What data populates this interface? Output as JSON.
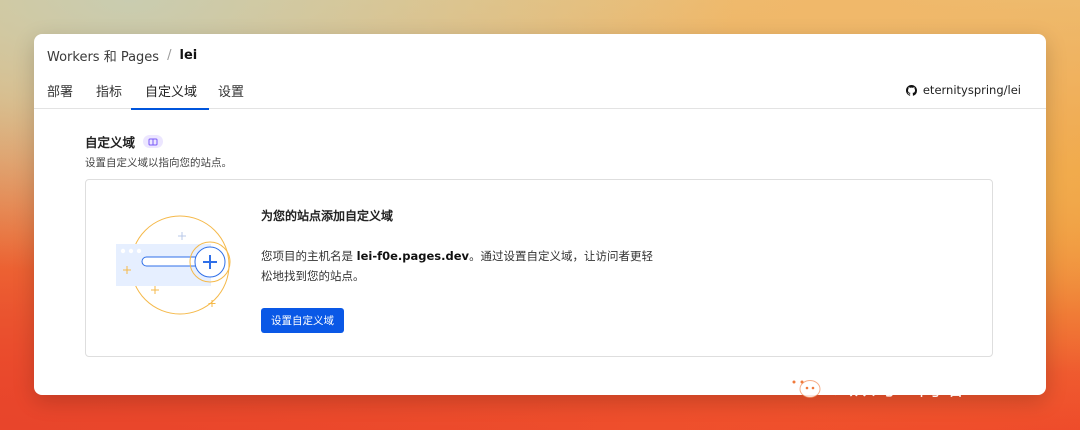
{
  "breadcrumb": {
    "parent": "Workers 和 Pages",
    "separator": "/",
    "current": "lei"
  },
  "tabs": [
    {
      "label": "部署",
      "active": false
    },
    {
      "label": "指标",
      "active": false
    },
    {
      "label": "自定义域",
      "active": true
    },
    {
      "label": "设置",
      "active": false
    }
  ],
  "repo": {
    "icon": "github-icon",
    "label": "eternityspring/lei"
  },
  "section": {
    "title": "自定义域",
    "badge_icon": "beta-icon",
    "description": "设置自定义域以指向您的站点。"
  },
  "card": {
    "heading": "为您的站点添加自定义域",
    "body_prefix": "您项目的主机名是 ",
    "hostname": "lei-f0e.pages.dev",
    "body_suffix": "。通过设置自定义域，让访问者更轻松地找到您的站点。",
    "button_label": "设置自定义域"
  },
  "watermark": {
    "text": "公众号 · 阿皓AI",
    "icon": "wechat-icon"
  },
  "colors": {
    "accent": "#0a58e6",
    "tab_underline": "#0055dc",
    "illustration_orange": "#f5b94a",
    "badge_bg": "#ece6ff"
  }
}
